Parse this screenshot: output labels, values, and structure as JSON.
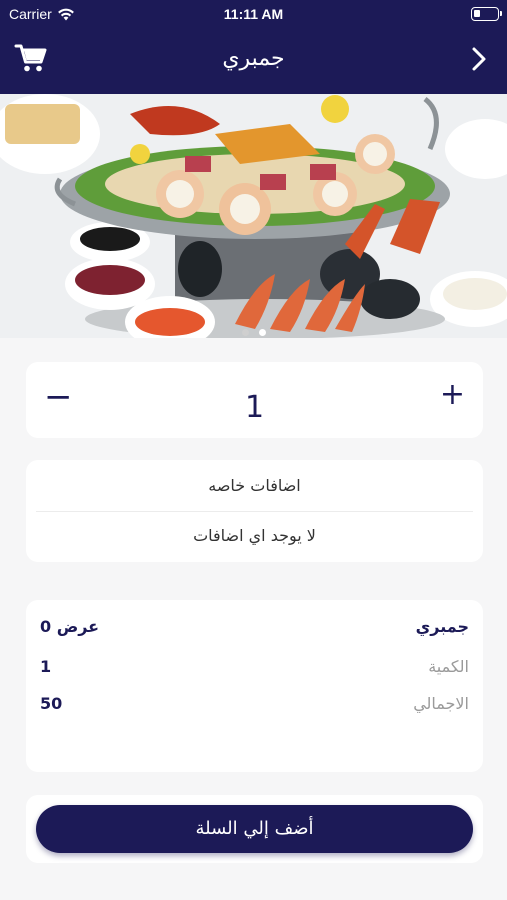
{
  "status_bar": {
    "carrier": "Carrier",
    "time": "11:11 AM"
  },
  "navbar": {
    "title": "جمبري",
    "cart_icon": "shopping-cart-icon",
    "back_icon": "chevron-right-icon"
  },
  "hero": {
    "image_icon": "seafood-platter-image",
    "slide_count": 2,
    "active_slide": 2
  },
  "quantity": {
    "minus": "−",
    "value": "1",
    "plus": "+"
  },
  "extras": {
    "heading": "اضافات خاصه",
    "none_text": "لا يوجد اي اضافات"
  },
  "summary": {
    "item_name": "جمبري",
    "offer": "0 عرض",
    "quantity_label": "الكمية",
    "quantity_value": "1",
    "total_label": "الاجمالي",
    "total_value": "50"
  },
  "cta": {
    "label": "أضف إلي السلة"
  },
  "colors": {
    "primary": "#1c1a57",
    "background": "#f6f6f7",
    "card": "#ffffff"
  }
}
